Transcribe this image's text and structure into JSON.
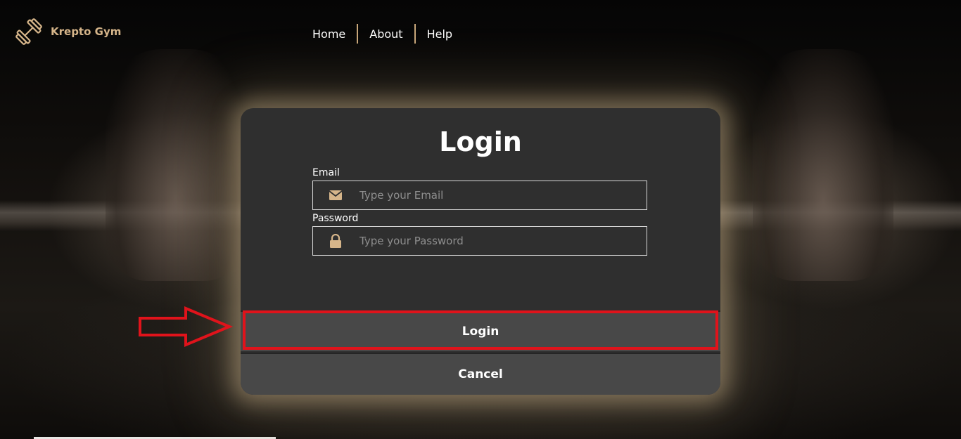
{
  "brand": {
    "name": "Krepto Gym",
    "icon": "dumbbell-icon",
    "color": "#d6b58a"
  },
  "nav": {
    "items": [
      "Home",
      "About",
      "Help"
    ]
  },
  "login": {
    "title": "Login",
    "email_label": "Email",
    "email_placeholder": "Type your Email",
    "email_icon": "envelope-icon",
    "password_label": "Password",
    "password_placeholder": "Type your Password",
    "password_icon": "lock-icon",
    "login_button": "Login",
    "cancel_button": "Cancel"
  },
  "annotation": {
    "arrow_color": "#e0131b",
    "highlight_target": "login-button"
  },
  "colors": {
    "accent": "#c9a77a",
    "panel_bg": "#2f2f2f",
    "button_bg": "#484848"
  }
}
